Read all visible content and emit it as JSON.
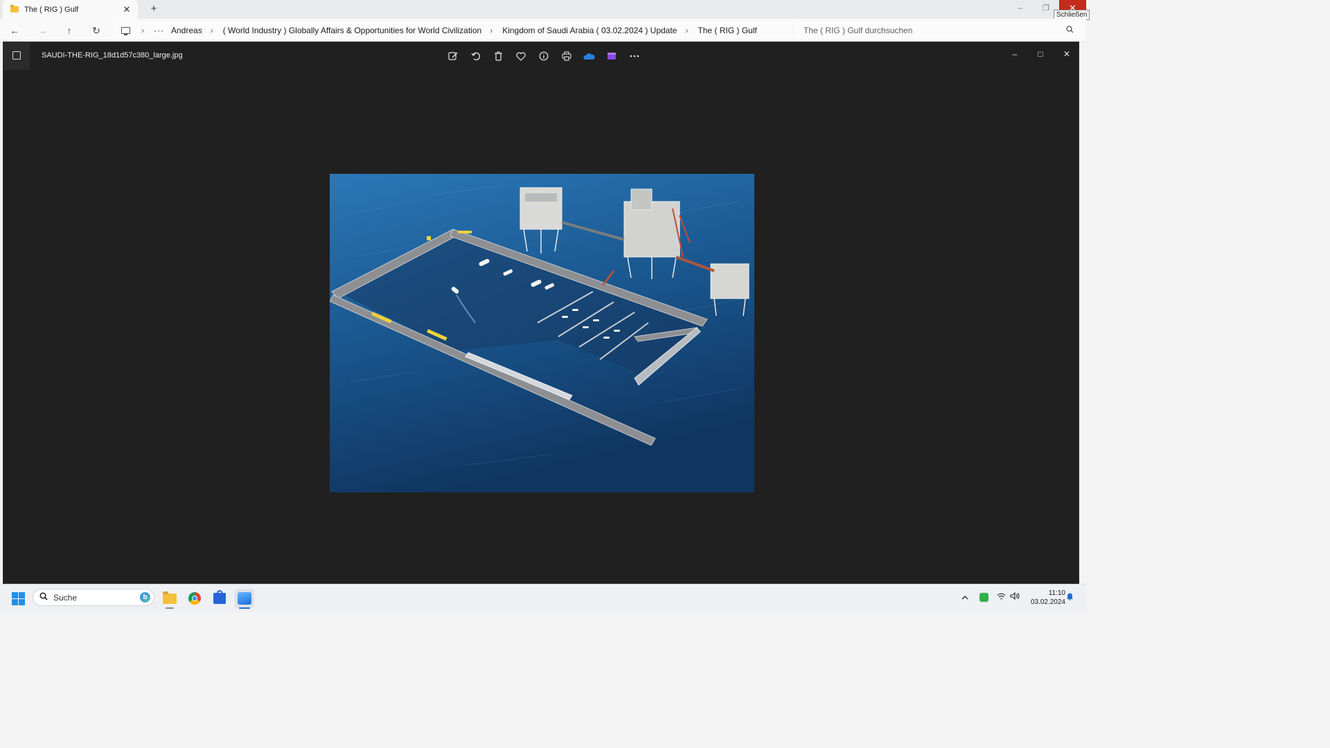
{
  "explorer": {
    "tab_title": "The ( RIG ) Gulf",
    "tab_close": "✕",
    "new_tab": "+",
    "window_controls": {
      "minimize": "–",
      "maximize": "❐",
      "close": "✕"
    },
    "close_tooltip": "Schließen",
    "nav": {
      "back": "←",
      "forward": "→",
      "up": "↑",
      "refresh": "↻"
    },
    "breadcrumb": {
      "overflow": "···",
      "separator": "›",
      "items": [
        "Andreas",
        "( World Industry ) Globally Affairs & Opportunities for World Civilization",
        "Kingdom of Saudi Arabia ( 03.02.2024 ) Update",
        "The ( RIG ) Gulf"
      ]
    },
    "search": {
      "placeholder": "The ( RIG ) Gulf durchsuchen",
      "icon": "search-icon"
    }
  },
  "photos_viewer": {
    "filename": "SAUDI-THE-RIG_18d1d57c380_large.jpg",
    "toolbar": [
      "edit-image",
      "rotate",
      "delete",
      "favorite",
      "info",
      "print",
      "onedrive",
      "clipchamp",
      "more"
    ],
    "window_controls": {
      "minimize": "–",
      "maximize": "□",
      "close": "✕"
    }
  },
  "taskbar": {
    "search_label": "Suche",
    "search_icon": "search-icon",
    "apps": [
      "file-explorer",
      "chrome",
      "microsoft-store",
      "photos"
    ],
    "tray": {
      "chevron": "^",
      "wifi": "wifi-icon",
      "volume": "volume-icon"
    },
    "time": "11:10",
    "date": "03.02.2024"
  },
  "colors": {
    "viewer_bg": "#202020",
    "close_red": "#c42b1c",
    "sea": "#1c5d97",
    "accent": "#1e6fd9"
  }
}
